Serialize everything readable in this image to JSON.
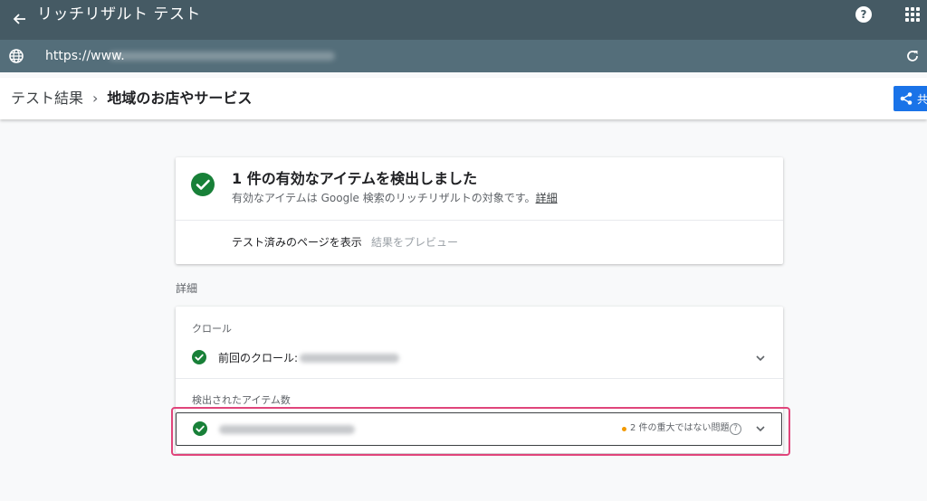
{
  "app": {
    "title": "リッチリザルト テスト"
  },
  "urlbar": {
    "url": "https://www."
  },
  "breadcrumb": {
    "parent": "テスト結果",
    "separator": "›",
    "current": "地域のお店やサービス"
  },
  "share": {
    "label": "共"
  },
  "summary": {
    "title": "1 件の有効なアイテムを検出しました",
    "subtitle": "有効なアイテムは Google 検索のリッチリザルトの対象です。",
    "detail_link": "詳細",
    "view_tested_page": "テスト済みのページを表示",
    "preview_results": "結果をプレビュー"
  },
  "details": {
    "section_label": "詳細",
    "crawl_label": "クロール",
    "last_crawl": "前回のクロール: ",
    "items_label": "検出されたアイテム数",
    "issues": "2 件の重大ではない問題",
    "issues_help": "?"
  },
  "colors": {
    "topbar": "#455a64",
    "urlbar": "#546e7a",
    "success": "#188038",
    "accent": "#1a73e8",
    "warning": "#f29900",
    "highlight": "#e0457b"
  },
  "icons": {
    "back": "arrow-left-icon",
    "help": "help-icon",
    "apps": "apps-grid-icon",
    "globe": "globe-icon",
    "reload": "reload-icon",
    "share": "share-icon",
    "check": "check-circle-icon",
    "expand": "chevron-down-icon"
  }
}
